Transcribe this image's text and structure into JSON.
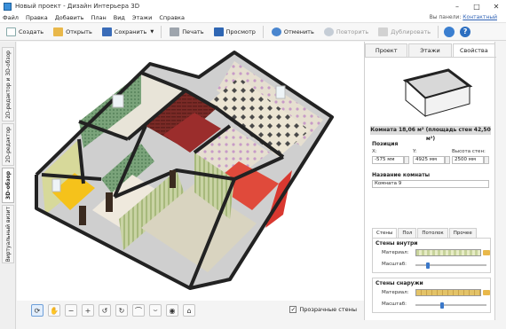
{
  "window": {
    "title": "Новый проект - Дизайн Интерьера 3D"
  },
  "menu": {
    "items": [
      "Файл",
      "Правка",
      "Добавить",
      "План",
      "Вид",
      "Этажи",
      "Справка"
    ],
    "help_prefix": "Вы панели:",
    "help_link": "Контактный"
  },
  "toolbar": {
    "create": "Создать",
    "open": "Открыть",
    "save": "Сохранить",
    "save_arrow": "▼",
    "print": "Печать",
    "preview": "Просмотр",
    "undo": "Отменить",
    "redo": "Повторить",
    "duplicate": "Дублировать"
  },
  "side_tabs": [
    "2D-редактор и 3D-обзор",
    "2D-редактор",
    "3D-обзор",
    "Виртуальный визит"
  ],
  "view_tools": {
    "icons": [
      "rotate-icon",
      "pan-hand-icon",
      "zoom-out-icon",
      "zoom-in-icon",
      "rotate-left-icon",
      "rotate-right-icon",
      "tilt-up-icon",
      "tilt-down-icon",
      "light-icon",
      "home-icon"
    ],
    "transparent_walls": "Прозрачные стены",
    "transparent_checked": true
  },
  "panel": {
    "tabs": [
      "Проект",
      "Этажи",
      "Свойства"
    ],
    "active_tab": 2,
    "room_info": "Комната 18,06 м² (площадь стен 42,50 м²)",
    "position_label": "Позиция",
    "x_label": "X:",
    "x_value": "-575 мм",
    "y_label": "Y:",
    "y_value": "4925 мм",
    "h_label": "Высота стен:",
    "h_value": "2500 мм",
    "name_label": "Название комнаты",
    "name_value": "Комната 9",
    "subtabs": [
      "Стены",
      "Пол",
      "Потолок",
      "Прочее"
    ],
    "inner_walls": "Стены внутри",
    "outer_walls": "Стены снаружи",
    "material_label": "Материал:",
    "scale_label": "Масштаб:",
    "inner_scale": 0.18,
    "outer_scale": 0.38
  },
  "colors": {
    "accent": "#3b78c9",
    "wall_top": "#2a2a2a",
    "green_wallpaper": "#6e9a6c",
    "red_floor": "#e0473a",
    "yellow_floor": "#f5c21b"
  }
}
